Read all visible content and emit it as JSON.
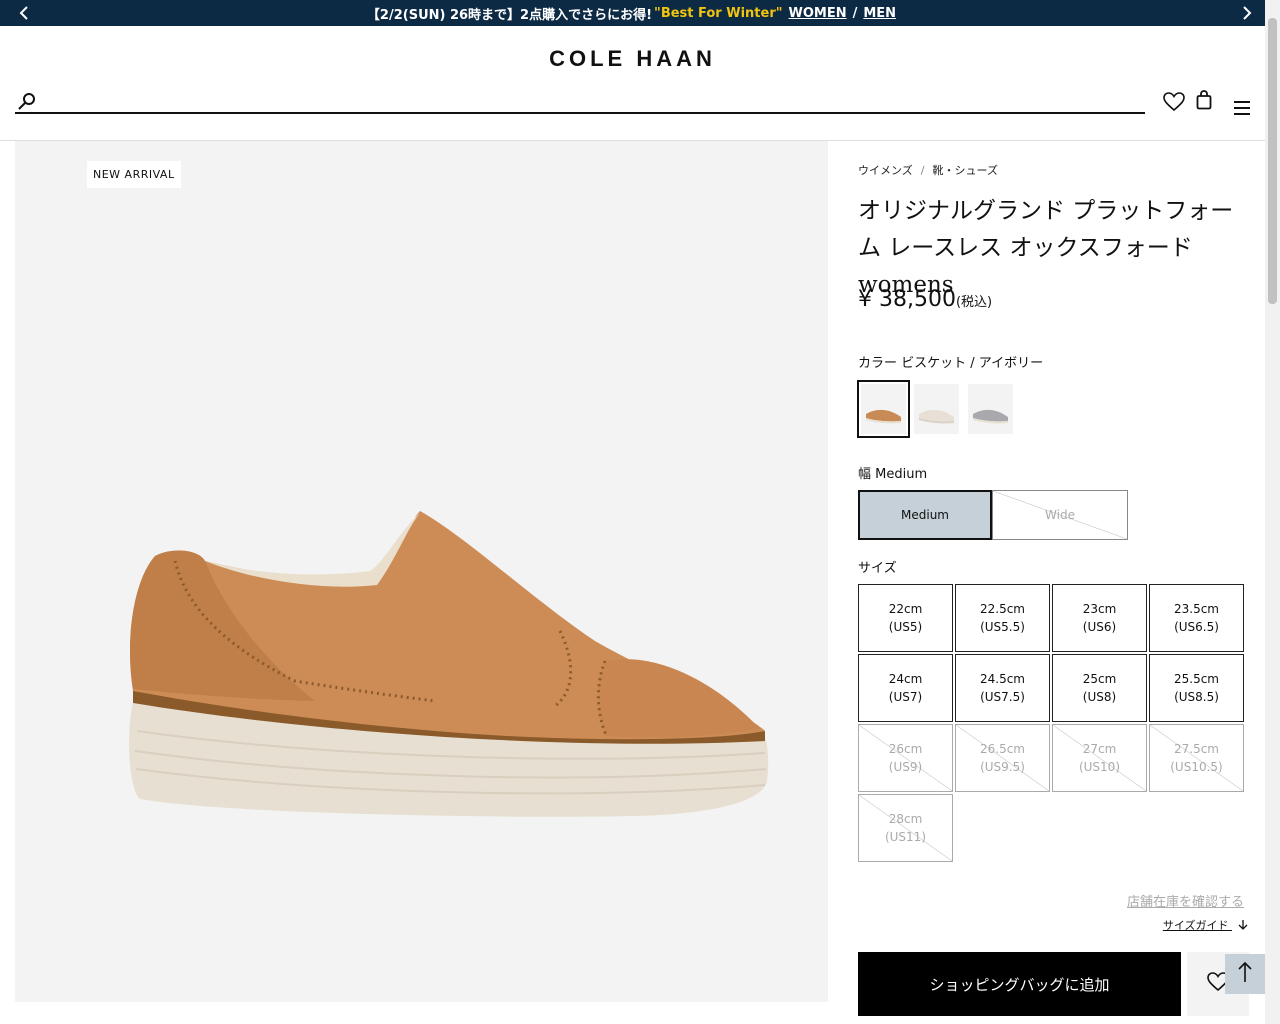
{
  "announcement": {
    "text": "【2/2(SUN) 26時まで】2点購入でさらにお得!",
    "highlight": "\"Best For Winter\"",
    "link_women": "WOMEN",
    "separator": "/",
    "link_men": "MEN"
  },
  "header": {
    "logo": "COLE HAAN",
    "search_placeholder": ""
  },
  "gallery": {
    "badge": "NEW ARRIVAL"
  },
  "breadcrumb": {
    "items": [
      "ウイメンズ",
      "靴・シューズ"
    ],
    "divider": "/"
  },
  "product": {
    "title": "オリジナルグランド プラットフォーム レースレス オックスフォード womens",
    "price": "¥ 38,500",
    "tax_note": "(税込)"
  },
  "color": {
    "label": "カラー ビスケット / アイボリー",
    "swatches": [
      {
        "name": "ビスケット / アイボリー",
        "hex": "#c98b55"
      },
      {
        "name": "ivory",
        "hex": "#e8e0d4"
      },
      {
        "name": "silver",
        "hex": "#a9a9ad"
      }
    ]
  },
  "width": {
    "label": "幅 Medium",
    "options": [
      {
        "label": "Medium",
        "selected": true,
        "available": true
      },
      {
        "label": "Wide",
        "selected": false,
        "available": false
      }
    ]
  },
  "size": {
    "label": "サイズ",
    "options": [
      {
        "cm": "22cm",
        "us": "(US5)",
        "available": true
      },
      {
        "cm": "22.5cm",
        "us": "(US5.5)",
        "available": true
      },
      {
        "cm": "23cm",
        "us": "(US6)",
        "available": true
      },
      {
        "cm": "23.5cm",
        "us": "(US6.5)",
        "available": true
      },
      {
        "cm": "24cm",
        "us": "(US7)",
        "available": true
      },
      {
        "cm": "24.5cm",
        "us": "(US7.5)",
        "available": true
      },
      {
        "cm": "25cm",
        "us": "(US8)",
        "available": true
      },
      {
        "cm": "25.5cm",
        "us": "(US8.5)",
        "available": true
      },
      {
        "cm": "26cm",
        "us": "(US9)",
        "available": false
      },
      {
        "cm": "26.5cm",
        "us": "(US9.5)",
        "available": false
      },
      {
        "cm": "27cm",
        "us": "(US10)",
        "available": false
      },
      {
        "cm": "27.5cm",
        "us": "(US10.5)",
        "available": false
      },
      {
        "cm": "28cm",
        "us": "(US11)",
        "available": false
      }
    ]
  },
  "links": {
    "store_stock": "店舗在庫を確認する",
    "size_guide": "サイズガイド"
  },
  "actions": {
    "add_to_bag": "ショッピングバッグに追加"
  },
  "colors": {
    "announce_bg": "#0d2a45",
    "highlight": "#f1c40f",
    "selected_bg": "#c5d0d8"
  }
}
